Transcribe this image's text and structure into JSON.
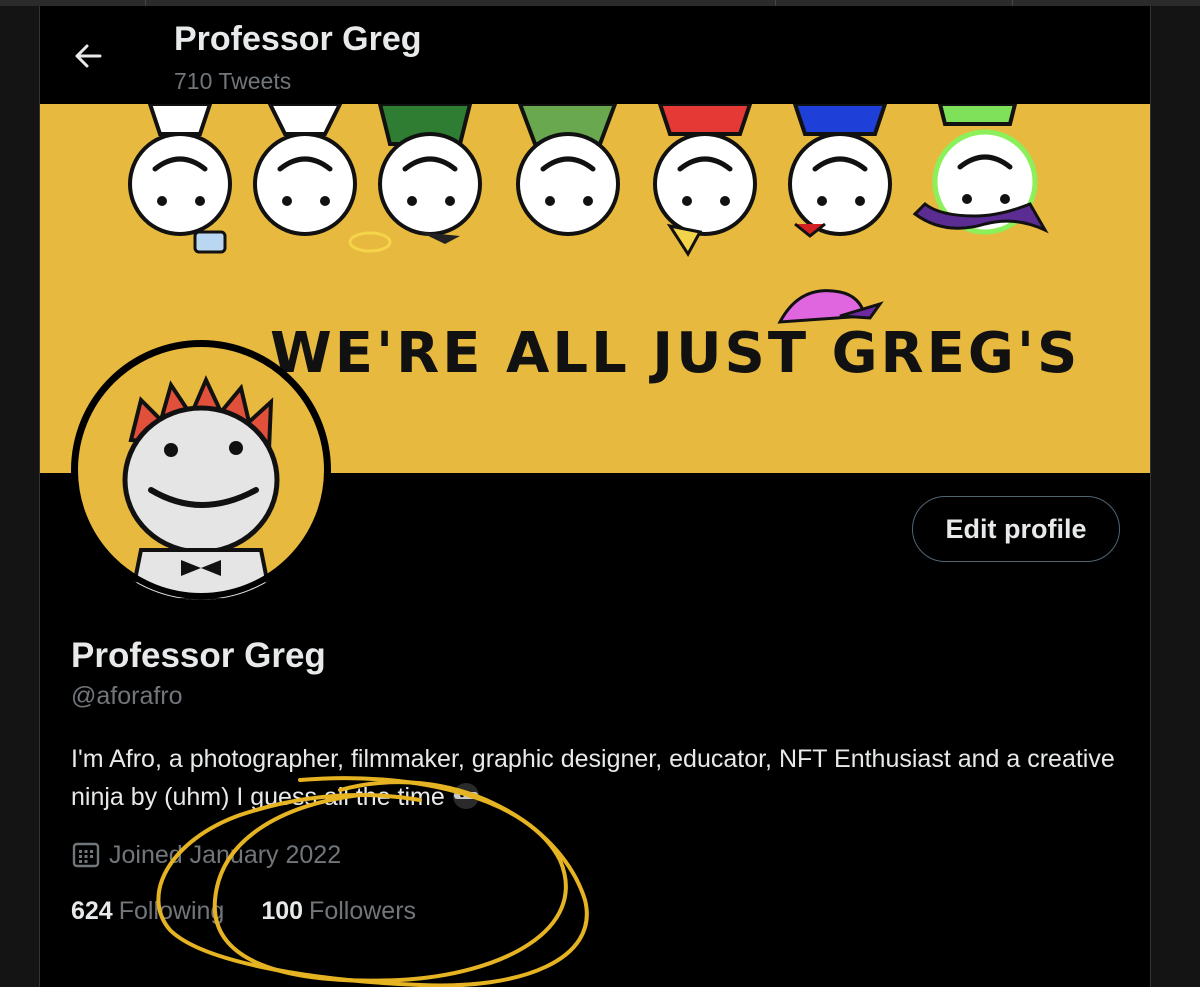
{
  "header": {
    "back_icon": "arrow-left-icon",
    "display_name": "Professor Greg",
    "tweet_count": "710 Tweets"
  },
  "banner": {
    "text": "WE'RE ALL JUST GREG'S",
    "background": "#e8b93f"
  },
  "profile": {
    "display_name": "Professor Greg",
    "handle": "@aforafro",
    "bio": "I'm Afro, a photographer, filmmaker, graphic designer, educator, NFT Enthusiast and a creative ninja by (uhm) I guess all the time",
    "bio_emoji_icon": "ninja-icon",
    "joined": "Joined January 2022",
    "calendar_icon": "calendar-icon",
    "edit_profile_label": "Edit profile",
    "following_count": "624",
    "following_label": "Following",
    "followers_count": "100",
    "followers_label": "Followers"
  },
  "colors": {
    "background": "#000000",
    "text_primary": "#e7e9ea",
    "text_secondary": "#71767b",
    "annotation": "#e6b422"
  }
}
